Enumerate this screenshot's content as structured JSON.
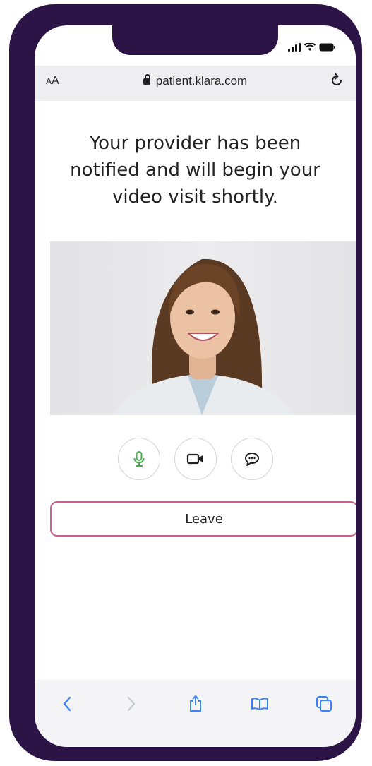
{
  "browser": {
    "text_size_label": "AA",
    "url": "patient.klara.com"
  },
  "page": {
    "headline": "Your provider has been notified and will begin your video visit shortly."
  },
  "call_controls": {
    "mic_icon": "microphone-icon",
    "camera_icon": "video-camera-icon",
    "chat_icon": "chat-bubble-icon",
    "mic_color": "#4caf50"
  },
  "leave_button": {
    "label": "Leave",
    "border_color": "#c9638d"
  },
  "toolbar": {
    "items": [
      "back-icon",
      "forward-icon",
      "share-icon",
      "bookmarks-icon",
      "tabs-icon"
    ],
    "accent": "#3b82f6"
  },
  "theme": {
    "frame_color": "#2d1446"
  }
}
